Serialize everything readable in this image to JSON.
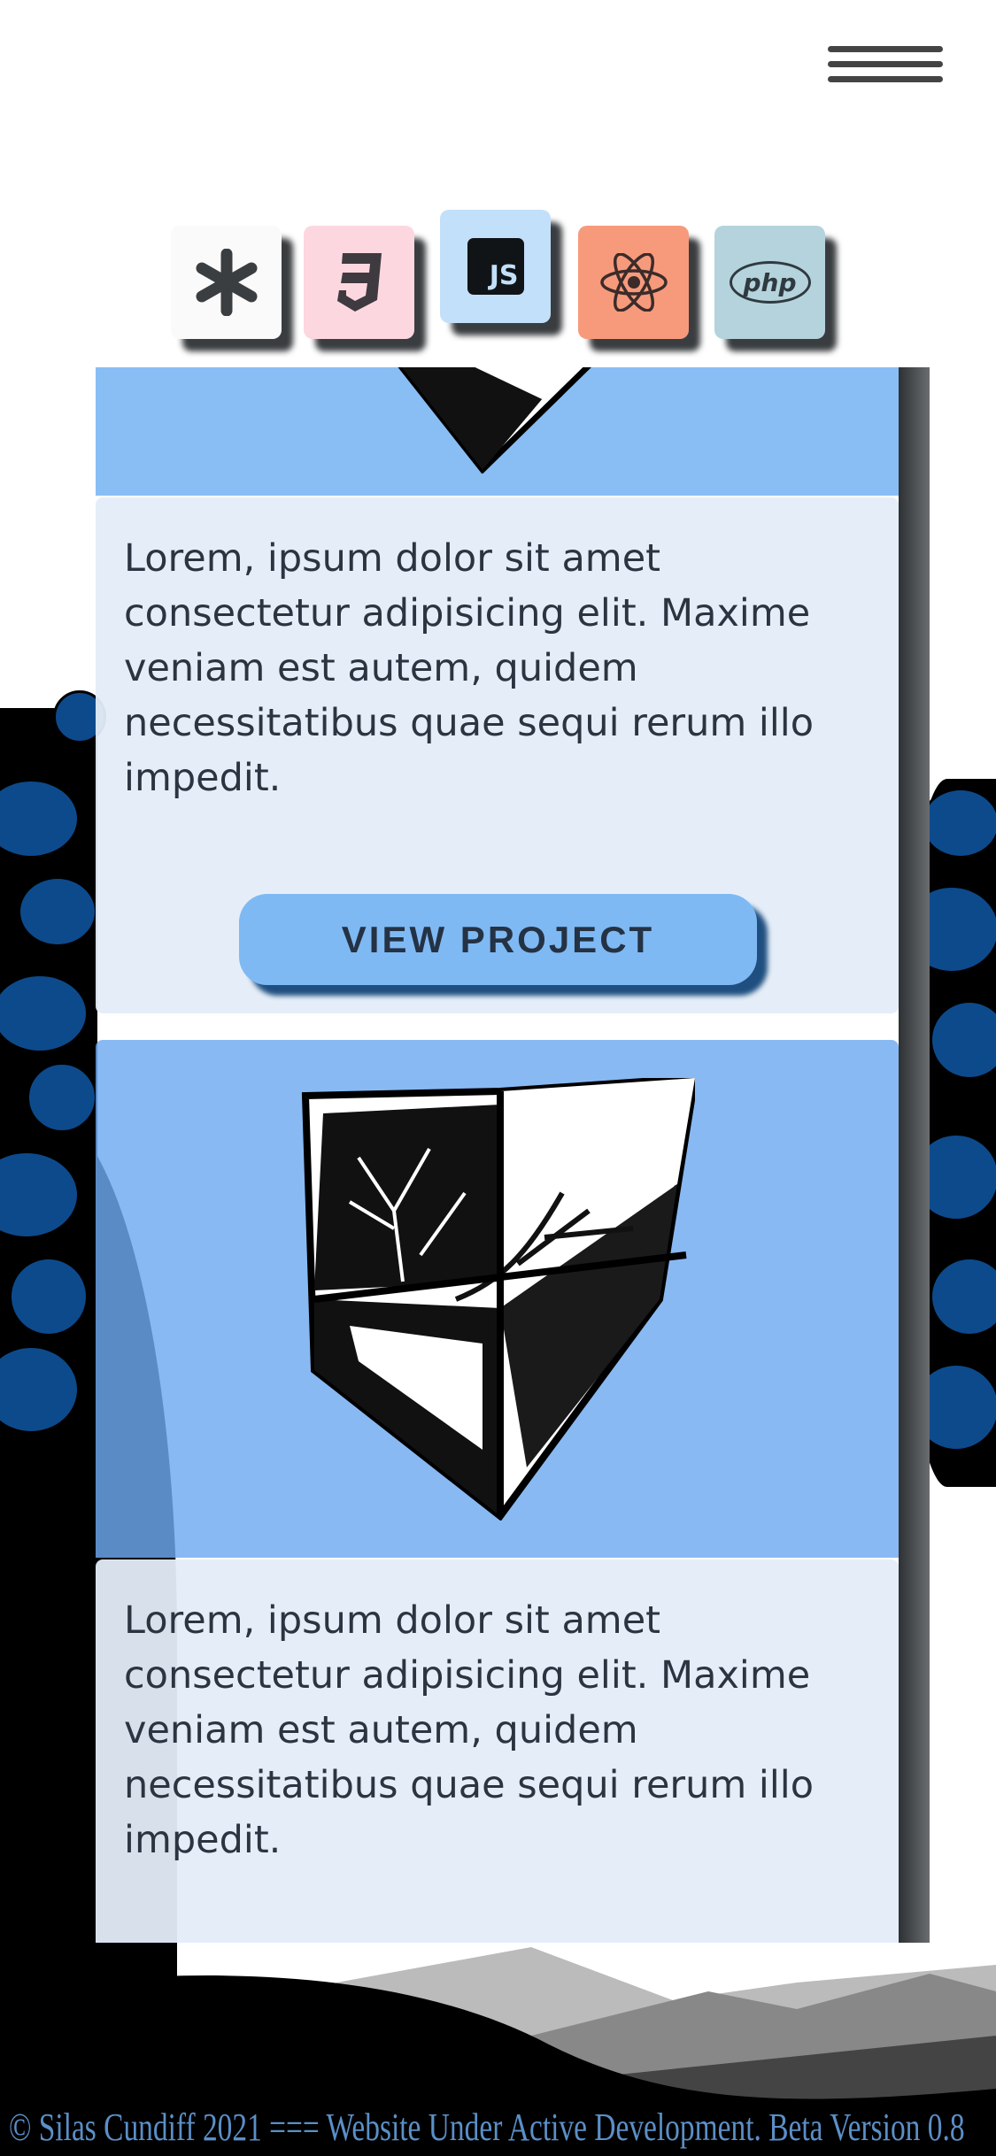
{
  "nav": {
    "menu_icon": "hamburger-icon"
  },
  "tech_icons": [
    {
      "name": "asterisk-icon",
      "bg": "#fafafa"
    },
    {
      "name": "css3-icon",
      "bg": "#fdd7e0"
    },
    {
      "name": "javascript-icon",
      "bg": "#c2e0fa",
      "label": "JS"
    },
    {
      "name": "react-icon",
      "bg": "#f79a7c"
    },
    {
      "name": "php-icon",
      "bg": "#b5d3dd",
      "label": "php"
    }
  ],
  "projects": [
    {
      "description": "Lorem, ipsum dolor sit amet consectetur adipisicing elit. Maxime veniam est autem, quidem necessitatibus quae sequi rerum illo impedit.",
      "button": "VIEW PROJECT"
    },
    {
      "description": "Lorem, ipsum dolor sit amet consectetur adipisicing elit. Maxime veniam est autem, quidem necessitatibus quae sequi rerum illo impedit."
    }
  ],
  "footer": {
    "text": "© Silas Cundiff 2021 === Website Under Active Development. Beta Version 0.8"
  },
  "colors": {
    "accent": "#7fb9f3",
    "image_bg": "#89bef5",
    "footer_text": "#5b8fc7"
  }
}
